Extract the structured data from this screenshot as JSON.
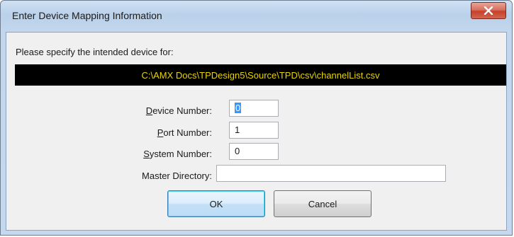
{
  "window": {
    "title": "Enter Device Mapping Information",
    "close_label": "x"
  },
  "dialog": {
    "prompt": "Please specify the intended device for:",
    "path": "C:\\AMX Docs\\TPDesign5\\Source\\TPD\\csv\\channelList.csv"
  },
  "fields": {
    "device_number": {
      "label_access": "D",
      "label_rest": "evice Number:",
      "value": "0"
    },
    "port_number": {
      "label_access": "P",
      "label_rest": "ort Number:",
      "value": "1"
    },
    "system_number": {
      "label_access": "S",
      "label_rest": "ystem Number:",
      "value": "0"
    },
    "master_directory": {
      "label": "Master Directory:",
      "value": ""
    }
  },
  "buttons": {
    "ok_label": "OK",
    "cancel_label": "Cancel"
  },
  "colors": {
    "path_background": "#000000",
    "path_text": "#e8d400",
    "close_button": "#c7402b",
    "selection": "#3399ff"
  }
}
